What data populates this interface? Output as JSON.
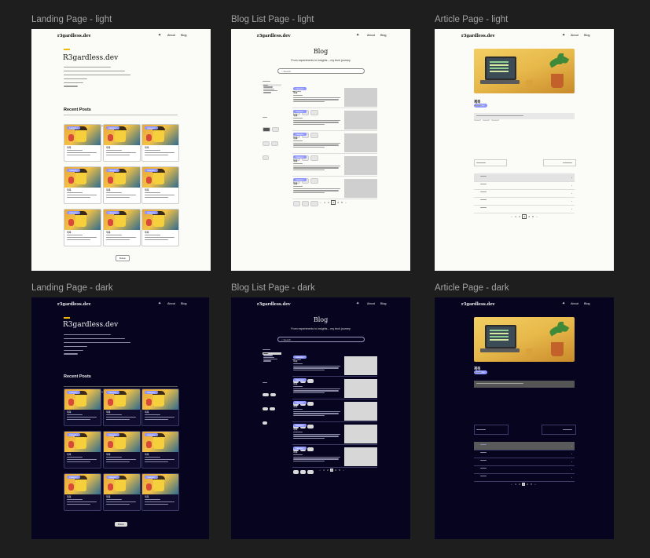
{
  "frames": [
    {
      "id": "landing-light",
      "label": "Landing Page - light"
    },
    {
      "id": "bloglist-light",
      "label": "Blog List Page - light"
    },
    {
      "id": "article-light",
      "label": "Article Page - light"
    },
    {
      "id": "landing-dark",
      "label": "Landing Page - dark"
    },
    {
      "id": "bloglist-dark",
      "label": "Blog List Page - dark"
    },
    {
      "id": "article-dark",
      "label": "Article Page - dark"
    }
  ],
  "site": {
    "logo": "r3gardless.dev",
    "nav_about": "About",
    "nav_blog": "Blog",
    "theme_icon": "✦"
  },
  "landing": {
    "hero_title": "R3gardless.dev",
    "recent_posts": "Recent Posts",
    "view_more": "Button"
  },
  "bloglist": {
    "title": "Blog",
    "subtitle": "From experiments to insights – my tech journey",
    "search_placeholder": "Search"
  },
  "article": {
    "post_title": "제목"
  },
  "cards": {
    "title": "제목",
    "tag": "Category"
  },
  "colors": {
    "canvas": "#1e1e1e",
    "light_bg": "#fbfbf8",
    "dark_bg": "#070420",
    "accent": "#8e95ff"
  }
}
